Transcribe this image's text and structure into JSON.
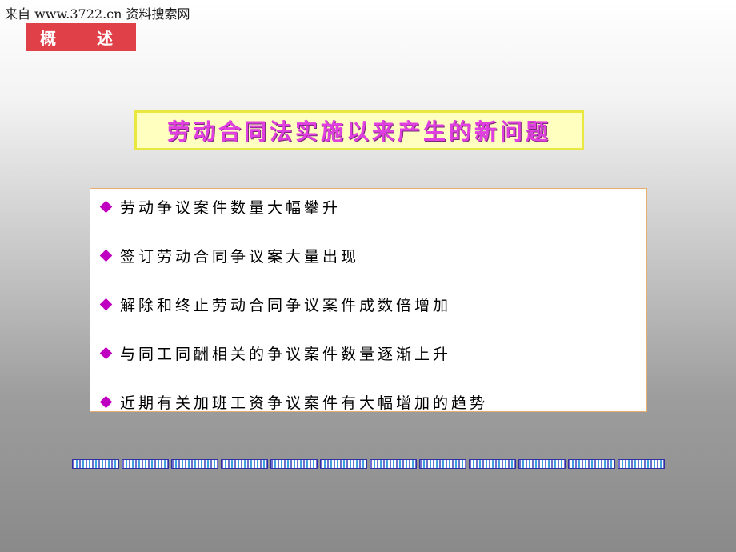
{
  "watermark": "来自 www.3722.cn 资料搜索网",
  "section_tab": "概 述",
  "title": "劳动合同法实施以来产生的新问题",
  "items": [
    "劳动争议案件数量大幅攀升",
    "签订劳动合同争议案大量出现",
    "解除和终止劳动合同争议案件成数倍增加",
    "与同工同酬相关的争议案件数量逐渐上升",
    "近期有关加班工资争议案件有大幅增加的趋势"
  ],
  "colors": {
    "tab_bg": "#e04048",
    "title_text": "#e040e0",
    "title_bg": "#ffffc0",
    "bullet": "#c000c0"
  },
  "icons": {
    "bullet": "diamond-bullet-icon"
  }
}
